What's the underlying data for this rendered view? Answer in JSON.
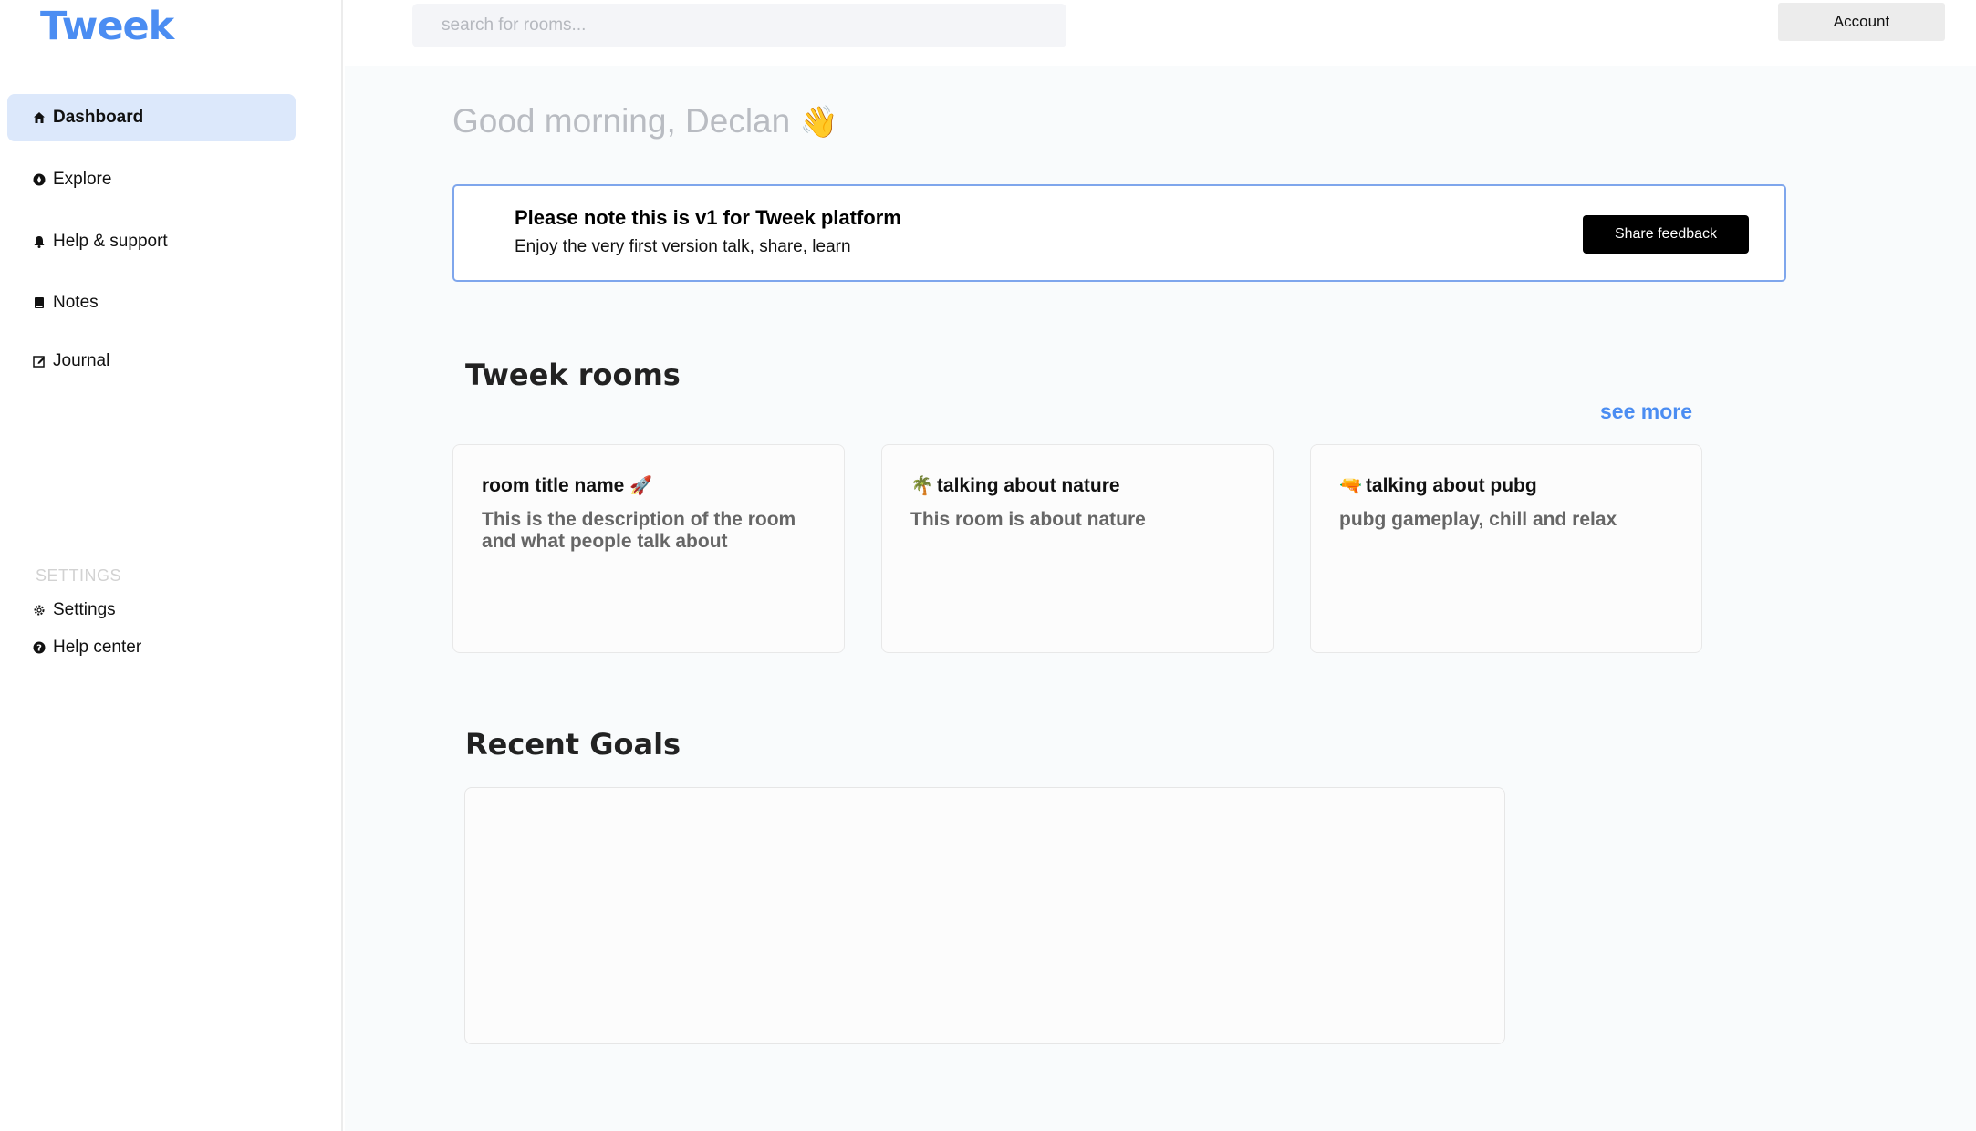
{
  "app": {
    "logo": "Tweek"
  },
  "sidebar": {
    "items": [
      {
        "label": "Dashboard",
        "icon": "home-icon",
        "active": true
      },
      {
        "label": "Explore",
        "icon": "compass-icon"
      },
      {
        "label": "Help & support",
        "icon": "bell-icon"
      },
      {
        "label": "Notes",
        "icon": "notebook-icon"
      },
      {
        "label": "Journal",
        "icon": "edit-icon"
      }
    ],
    "settings_heading": "SETTINGS",
    "settings_items": [
      {
        "label": "Settings",
        "icon": "gear-icon"
      },
      {
        "label": "Help center",
        "icon": "question-icon"
      }
    ]
  },
  "header": {
    "search_placeholder": "search for rooms...",
    "account_label": "Account"
  },
  "main": {
    "greeting": "Good morning, Declan",
    "greeting_emoji": "👋",
    "banner": {
      "title": "Please note this is v1 for Tweek platform",
      "subtitle": "Enjoy the very first version talk, share, learn",
      "button_label": "Share feedback"
    },
    "rooms_section": {
      "title": "Tweek rooms",
      "see_more_label": "see more",
      "rooms": [
        {
          "title": "room title name",
          "emoji": "🚀",
          "emoji_position": "after",
          "description": "This is the description of the room and what people talk about"
        },
        {
          "title": "talking about nature",
          "emoji": "🌴",
          "emoji_position": "before",
          "description": "This room is about nature"
        },
        {
          "title": "talking about pubg",
          "emoji": "🔫",
          "emoji_position": "before",
          "description": "pubg gameplay, chill and relax"
        }
      ]
    },
    "goals_section": {
      "title": "Recent Goals"
    }
  },
  "colors": {
    "brand": "#4b8df2",
    "active_nav_bg": "#dce8fb",
    "banner_border": "#7fa6ec",
    "button_dark": "#000000",
    "main_bg": "#f9fbfc"
  }
}
